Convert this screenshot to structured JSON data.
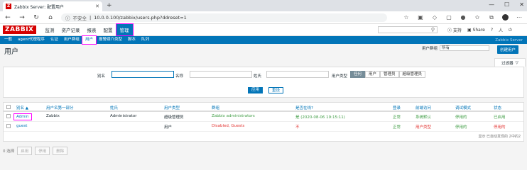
{
  "browser": {
    "tab_title": "Zabbix Server: 配置用户",
    "favicon_letter": "Z",
    "insecure_label": "不安全",
    "url": "10.0.0.100/zabbix/users.php?ddreset=1"
  },
  "zabbix": {
    "logo": "ZABBIX",
    "menu": [
      "监测",
      "资产记录",
      "报表",
      "配置",
      "管理"
    ],
    "support": "支持",
    "share": "Share",
    "help": "?",
    "user_icon": "人",
    "logout": "⏻",
    "submenu": [
      "一般",
      "agent代理程序",
      "认证",
      "用户群组",
      "用户",
      "报警媒介类型",
      "脚本",
      "队列"
    ],
    "server_name": "Zabbix Server"
  },
  "page": {
    "title": "用户",
    "usergroup_label": "用户群组",
    "usergroup_value": "所有",
    "create_button": "创建用户",
    "filter_tab": "过滤器"
  },
  "filter": {
    "alias_label": "别名",
    "name_label": "名称",
    "surname_label": "姓氏",
    "type_label": "用户类型",
    "type_options": [
      "任何",
      "用户",
      "管理员",
      "超级管理员"
    ],
    "apply": "应用",
    "reset": "重设"
  },
  "table": {
    "headers": [
      "别名 ▲",
      "用户名第一部分",
      "姓氏",
      "用户类型",
      "群组",
      "是否在线?",
      "登录",
      "前端访问",
      "调试模式",
      "状态"
    ],
    "rows": [
      [
        "Admin",
        "Zabbix",
        "Administrator",
        "超级管理员",
        "Zabbix administrators",
        "是 (2020-08-06 19:15:11)",
        "正常",
        "系统默认",
        "停用的",
        "已启用"
      ],
      [
        "guest",
        "",
        "",
        "用户",
        "Disabled, Guests",
        "不",
        "正常",
        "用户类型",
        "停用的",
        "停用的"
      ]
    ],
    "footer": "显示 已自动发现的 2中的2"
  },
  "bottom": {
    "selected": "0 选择",
    "enable": "启用",
    "disable": "停用",
    "delete": "删除"
  }
}
